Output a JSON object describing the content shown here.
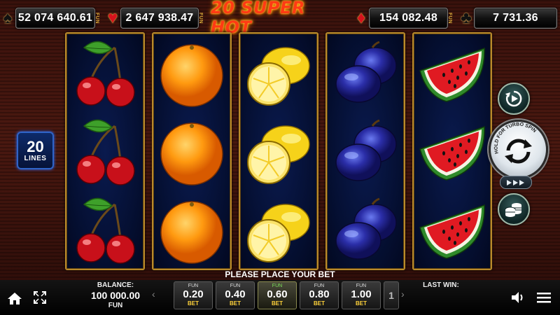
{
  "jackpots": [
    {
      "suit": "spade",
      "suit_glyph": "♠",
      "value": "52 074 640.61",
      "tag": "FUN"
    },
    {
      "suit": "heart",
      "suit_glyph": "♥",
      "value": "2 647 938.47",
      "tag": "FUN"
    },
    {
      "suit": "diamond",
      "suit_glyph": "♦",
      "value": "154 082.48",
      "tag": "FUN"
    },
    {
      "suit": "club",
      "suit_glyph": "♣",
      "value": "7 731.36",
      "tag": "FUN"
    }
  ],
  "game_title": "20 SUPER HOT",
  "lines": {
    "count": "20",
    "label": "LINES"
  },
  "reels": [
    [
      "cherry",
      "cherry",
      "cherry"
    ],
    [
      "orange",
      "orange",
      "orange"
    ],
    [
      "lemon",
      "lemon",
      "lemon"
    ],
    [
      "plum",
      "plum",
      "plum"
    ],
    [
      "watermelon",
      "watermelon",
      "watermelon"
    ]
  ],
  "controls": {
    "autoplay_icon": "autoplay-icon",
    "spin_icon": "spin-icon",
    "spin_hint": "HOLD FOR TURBO SPIN",
    "turbo_icon": "turbo-icon",
    "coins_icon": "coins-icon"
  },
  "prompt": "PLEASE PLACE YOUR BET",
  "balance": {
    "label": "BALANCE:",
    "value": "100 000.00",
    "currency": "FUN"
  },
  "last_win": {
    "label": "LAST WIN:"
  },
  "bets": [
    {
      "currency": "FUN",
      "value": "0.20",
      "label": "BET",
      "active": false
    },
    {
      "currency": "FUN",
      "value": "0.40",
      "label": "BET",
      "active": false
    },
    {
      "currency": "FUN",
      "value": "0.60",
      "label": "BET",
      "active": true
    },
    {
      "currency": "FUN",
      "value": "0.80",
      "label": "BET",
      "active": false
    },
    {
      "currency": "FUN",
      "value": "1.00",
      "label": "BET",
      "active": false
    }
  ],
  "bets_more": "1",
  "bets_prev_arrow": "‹",
  "bets_next_arrow": "›",
  "colors": {
    "accent_gold": "#b98a2b",
    "reel_bg": "#051034",
    "bet_yellow": "#ffd23a",
    "active_green": "#7de05a",
    "title_red": "#ff3b14"
  }
}
